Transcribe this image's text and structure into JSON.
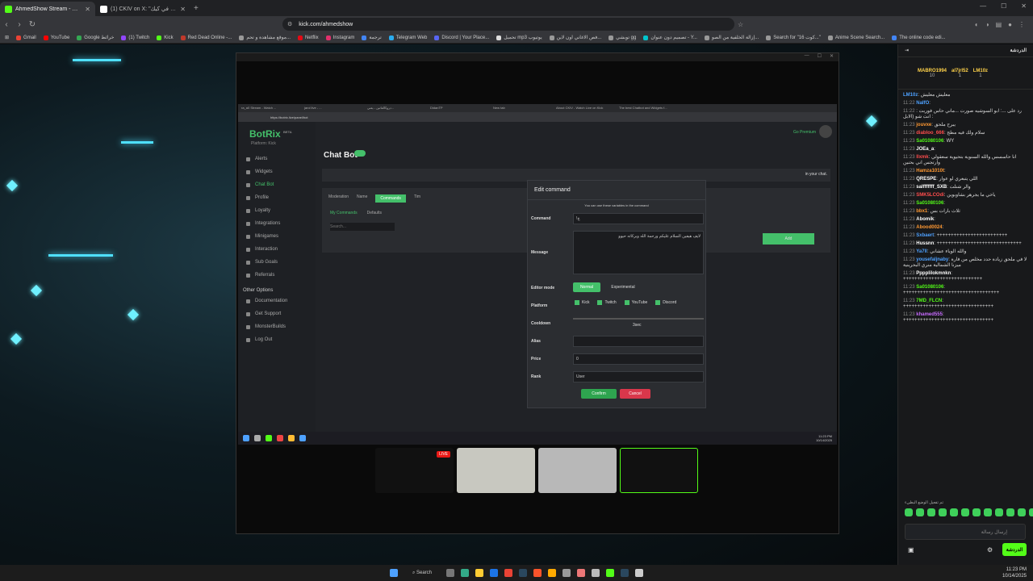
{
  "tabs": [
    {
      "title": "AhmedShow Stream - Watch Live",
      "active": true,
      "color": "#53fc18"
    },
    {
      "title": "(1) CKIV on X: \"تحولات ابونها في كيك\"",
      "active": false,
      "color": "#ffffff"
    }
  ],
  "new_tab": "+",
  "url": "kick.com/ahmedshow",
  "bookmarks": [
    {
      "label": "Gmail",
      "color": "#ea4335"
    },
    {
      "label": "YouTube",
      "color": "#ff0000"
    },
    {
      "label": "Google خرائط",
      "color": "#34a853"
    },
    {
      "label": "(1) Twitch",
      "color": "#9146ff"
    },
    {
      "label": "Kick",
      "color": "#53fc18"
    },
    {
      "label": "Red Dead Online -...",
      "color": "#c0392b"
    },
    {
      "label": "موقع مشاهدة و تحم...",
      "color": "#999"
    },
    {
      "label": "Netflix",
      "color": "#e50914"
    },
    {
      "label": "Instagram",
      "color": "#e1306c"
    },
    {
      "label": "ترجمة",
      "color": "#4285f4"
    },
    {
      "label": "Telegram Web",
      "color": "#2aabee"
    },
    {
      "label": "Discord | Your Place...",
      "color": "#5865f2"
    },
    {
      "label": "تحميل mp3 يوتيوب",
      "color": "#ddd"
    },
    {
      "label": "فص الاغاني اون لاين...",
      "color": "#999"
    },
    {
      "label": "توبشي gg",
      "color": "#999"
    },
    {
      "label": "تصميم دون عنوان - Y...",
      "color": "#00c4cc"
    },
    {
      "label": "إزالة الخلفية من الصو...",
      "color": "#999"
    },
    {
      "label": "Search for \"كوت 16...\"",
      "color": "#999"
    },
    {
      "label": "Anime Scene Search...",
      "color": "#999"
    },
    {
      "label": "The online code edi...",
      "color": "#4285f4"
    }
  ],
  "inner_tabs": [
    "ra_a0 Stream - Watch ...",
    "jarol live - ...",
    "دروكالفاتين - يعني...",
    "DidanTP",
    "New tab",
    "About CKIV - Watch Live on Kick",
    "The best Chatbot and Widgets f..."
  ],
  "inner_url": "https://botrix.live/panel/bot",
  "botrix": {
    "logo": "BotRix",
    "badge": "BETA",
    "platform": "Platform: Kick",
    "menu": [
      "Alerts",
      "Widgets",
      "Chat Bot",
      "Profile",
      "Loyalty",
      "Integrations",
      "Minigames",
      "Interaction",
      "Sub Goals",
      "Referrals"
    ],
    "other_header": "Other Options",
    "other": [
      "Documentation",
      "Get Support",
      "MonsterBuilds",
      "Log Out"
    ],
    "page_title": "Chat Bot",
    "go_premium": "Go Premium",
    "tabs": [
      "Moderation",
      "Name",
      "Commands",
      "Tim"
    ],
    "subtabs": [
      "My Commands",
      "Defaults"
    ],
    "search_placeholder": "Search...",
    "add": "Add",
    "notice": "in your chat."
  },
  "modal": {
    "title": "Edit command",
    "hint": "You can use these variables in the command",
    "command_label": "Command",
    "command_value": "!ج",
    "message_label": "Message",
    "message_value": "لايف هيفين السلام عليكم ورحمة الله وبركاته حيوو",
    "editor_label": "Editor mode",
    "editor_normal": "Normal",
    "editor_experimental": "Experimental",
    "platform_label": "Platform",
    "platforms": [
      "Kick",
      "Twitch",
      "YouTube",
      "Discord"
    ],
    "cooldown_label": "Cooldown",
    "cooldown_value": "3sec",
    "alias_label": "Alias",
    "price_label": "Price",
    "price_value": "0",
    "rank_label": "Rank",
    "rank_value": "User",
    "confirm": "Confirm",
    "cancel": "Cancel"
  },
  "inner_clock": {
    "time": "11:23 PM",
    "date": "10/14/2025"
  },
  "live_badge": "LIVE",
  "chat": {
    "title": "الدردشة",
    "leaders": [
      {
        "name": "MABRO1994",
        "value": "10"
      },
      {
        "name": "al7jrl52",
        "value": "1"
      },
      {
        "name": "LM10z",
        "value": "1"
      }
    ],
    "messages": [
      {
        "time": "",
        "user": "LM10z",
        "color": "#4ea1ff",
        "text": "معليش معليش"
      },
      {
        "time": "11:22",
        "user": "NaIfO",
        "color": "#4ea1ff",
        "text": ""
      },
      {
        "time": "11:22",
        "user": "",
        "color": "#ddd",
        "text": "رد على ...: ابو السوشيه صورت ...ماني حاس فوربت انت شو (الابل :"
      },
      {
        "time": "11:23",
        "user": "jouvxe",
        "color": "#ff9933",
        "text": "يبرح ملحق"
      },
      {
        "time": "11:23",
        "user": "diabloo_666",
        "color": "#ff4d4d",
        "text": "سلام ولك فيه مطج"
      },
      {
        "time": "11:23",
        "user": "Sa01080106",
        "color": "#53fc18",
        "text": "WY"
      },
      {
        "time": "11:23",
        "user": "JOEa_a",
        "color": "#ffffff",
        "text": ""
      },
      {
        "time": "11:23",
        "user": "llxmk",
        "color": "#ff4d4d",
        "text": "انا حاسسس والله السنوية بتحيوية سعقولي وارتجس اني بحنين"
      },
      {
        "time": "11:23",
        "user": "Hamza1010t",
        "color": "#ff9933",
        "text": ""
      },
      {
        "time": "11:23",
        "user": "QRESPE",
        "color": "#ffffff",
        "text": "اللي يتبعري لو عوار"
      },
      {
        "time": "11:23",
        "user": "salfffffff_SXB",
        "color": "#ffffff",
        "text": "والر شنلت"
      },
      {
        "time": "11:23",
        "user": "SMK5LCOdi",
        "color": "#ff4d4d",
        "text": "ياخي ما يجرهر بشاوبوين"
      },
      {
        "time": "11:23",
        "user": "Sa01080106",
        "color": "#53fc18",
        "text": ""
      },
      {
        "time": "11:23",
        "user": "bbx1",
        "color": "#ff9933",
        "text": "ثلاث بارات بس"
      },
      {
        "time": "11:23",
        "user": "Abomik",
        "color": "#ffffff",
        "text": ""
      },
      {
        "time": "11:23",
        "user": "Abood0024",
        "color": "#ff9933",
        "text": ""
      },
      {
        "time": "11:23",
        "user": "Sxbaert",
        "color": "#4ea1ff",
        "text": "+++++++++++++++++++++++++"
      },
      {
        "time": "11:23",
        "user": "Hussnn",
        "color": "#ffffff",
        "text": "++++++++++++++++++++++++++++++"
      },
      {
        "time": "11:23",
        "user": "Ya7ll",
        "color": "#4ea1ff",
        "text": "والله الوياء عشاني"
      },
      {
        "time": "11:23",
        "user": "yousefaljnaby",
        "color": "#4ea1ff",
        "text": "لا في ملحق زيادة حدد مخلص من فارة ميزنا الشمالية منري البحرينية"
      },
      {
        "time": "11:23",
        "user": "Pppplilokmnkn",
        "color": "#ffffff",
        "text": "++++++++++++++++++++++++++++"
      },
      {
        "time": "11:23",
        "user": "Sa01080106",
        "color": "#53fc18",
        "text": "++++++++++++++++++++++++++++++++++"
      },
      {
        "time": "11:23",
        "user": "7MD_FLCN",
        "color": "#53fc18",
        "text": "++++++++++++++++++++++++++++++++"
      },
      {
        "time": "11:23",
        "user": "khamed555",
        "color": "#c86bff",
        "text": "++++++++++++++++++++++++++++++++"
      }
    ],
    "system_note": "تم تفعيل الوضع البطيء",
    "input_placeholder": "إرسال رسالة",
    "send": "الدردشة"
  },
  "taskbar": {
    "search": "Search",
    "time": "11:23 PM",
    "date": "10/14/2025"
  }
}
